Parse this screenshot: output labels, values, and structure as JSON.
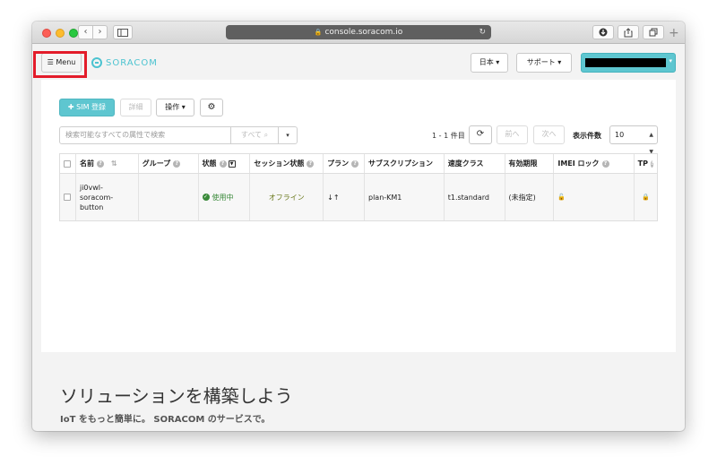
{
  "browser": {
    "url": "console.soracom.io",
    "back_glyph": "‹",
    "forward_glyph": "›"
  },
  "header": {
    "menu_label": "Menu",
    "logo_text": "SORACOM",
    "language_label": "日本",
    "support_label": "サポート"
  },
  "toolbar": {
    "sim_register_label": "SIM 登録",
    "detail_label": "詳細",
    "operations_label": "操作"
  },
  "search": {
    "placeholder": "検索可能なすべての属性で検索",
    "scope_label": "すべて"
  },
  "pagination": {
    "count_text": "1 - 1 件目",
    "prev_label": "前へ",
    "next_label": "次へ",
    "per_page_label": "表示件数",
    "per_page_value": "10"
  },
  "table": {
    "columns": [
      "名前",
      "グループ",
      "状態",
      "セッション状態",
      "プラン",
      "サブスクリプション",
      "速度クラス",
      "有効期限",
      "IMEI ロック",
      "TP"
    ],
    "rows": [
      {
        "name_lines": [
          "ji0vwl-",
          "soracom-",
          "button"
        ],
        "group": "",
        "status": "使用中",
        "session": "オフライン",
        "plan_icon": "↓↑",
        "subscription": "plan-KM1",
        "speed_class": "t1.standard",
        "expiry": "(未指定)"
      }
    ]
  },
  "footer": {
    "title": "ソリューションを構築しよう",
    "subtitle": "IoT をもっと簡単に。 SORACOM のサービスで。"
  },
  "colors": {
    "accent": "#5ec6d0",
    "highlight": "#e31c2a",
    "status_ok": "#3a8a3a"
  }
}
